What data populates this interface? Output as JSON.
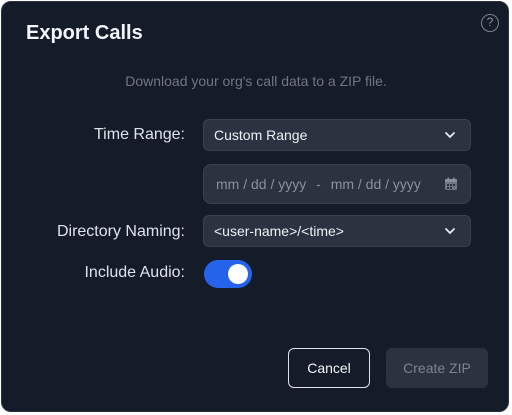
{
  "dialog": {
    "title": "Export Calls",
    "help_icon": "question-circle-icon",
    "description": "Download your org's call data to a ZIP file."
  },
  "form": {
    "time_range": {
      "label": "Time Range:",
      "value": "Custom Range"
    },
    "date_range": {
      "start_placeholder": "mm / dd / yyyy",
      "separator": "-",
      "end_placeholder": "mm / dd / yyyy",
      "icon": "calendar-icon"
    },
    "directory_naming": {
      "label": "Directory Naming:",
      "value": "<user-name>/<time>"
    },
    "include_audio": {
      "label": "Include Audio:",
      "enabled": true
    }
  },
  "buttons": {
    "cancel": "Cancel",
    "create": "Create ZIP"
  },
  "colors": {
    "background": "#141b29",
    "field": "#2b3240",
    "accent": "#2563eb"
  }
}
